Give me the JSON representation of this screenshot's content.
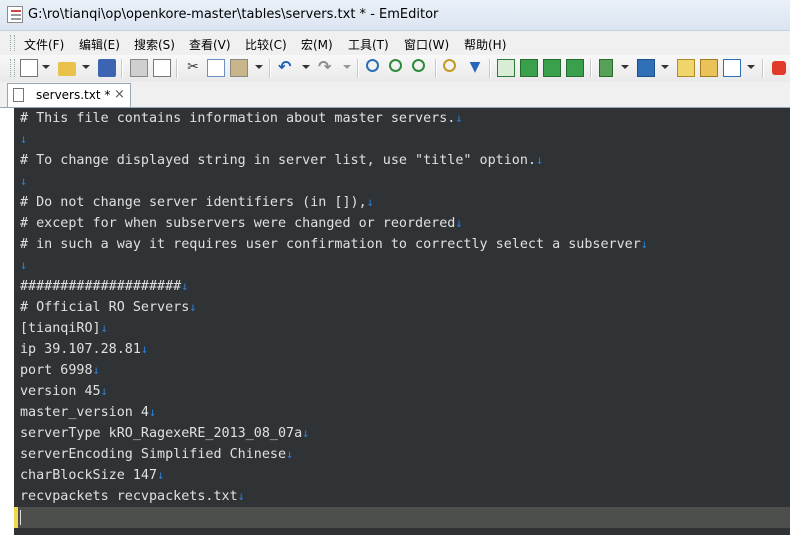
{
  "window": {
    "title": "G:\\ro\\tianqi\\op\\openkore-master\\tables\\servers.txt * - EmEditor"
  },
  "menu": {
    "items": [
      "文件(F)",
      "编辑(E)",
      "搜索(S)",
      "查看(V)",
      "比较(C)",
      "宏(M)",
      "工具(T)",
      "窗口(W)",
      "帮助(H)"
    ]
  },
  "toolbar": {
    "icons": [
      "new-file-icon",
      "open-folder-icon",
      "save-icon",
      "print-icon",
      "print-preview-icon",
      "cut-icon",
      "copy-icon",
      "paste-icon",
      "undo-icon",
      "redo-icon",
      "find-icon",
      "find-next-icon",
      "find-prev-icon",
      "find-in-files-icon",
      "filter-icon",
      "mark-icon",
      "wrap-icon",
      "refresh-icon",
      "sync-icon",
      "config-icon",
      "outline-icon",
      "customize-icon",
      "tools-icon",
      "check-icon",
      "stop-icon"
    ]
  },
  "tab": {
    "label": "servers.txt *",
    "close": "×"
  },
  "editor": {
    "eol_mark": "↓",
    "lines": [
      "# This file contains information about master servers.",
      "",
      "# To change displayed string in server list, use \"title\" option.",
      "",
      "# Do not change server identifiers (in []),",
      "# except for when subservers were changed or reordered",
      "# in such a way it requires user confirmation to correctly select a subserver",
      "",
      "####################",
      "# Official RO Servers",
      "[tianqiRO]",
      "ip 39.107.28.81",
      "port 6998",
      "version 45",
      "master_version 4",
      "serverType kRO_RagexeRE_2013_08_07a",
      "serverEncoding Simplified Chinese",
      "charBlockSize 147",
      "recvpackets recvpackets.txt"
    ]
  }
}
